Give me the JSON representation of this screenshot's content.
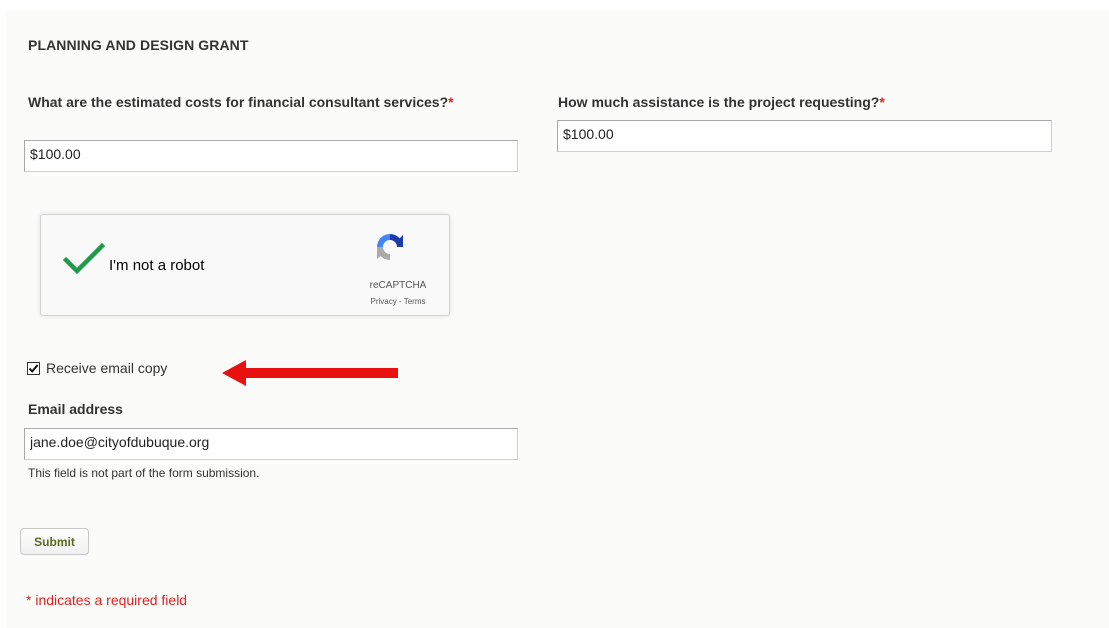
{
  "section": {
    "title": "PLANNING AND DESIGN GRANT"
  },
  "fields": {
    "consultant_costs": {
      "label": "What are the estimated costs for financial consultant services?",
      "required_marker": "*",
      "value": "$100.00"
    },
    "assistance": {
      "label": "How much assistance is the project requesting?",
      "required_marker": "*",
      "value": "$100.00"
    },
    "email": {
      "label": "Email address",
      "value": "jane.doe@cityofdubuque.org",
      "help": "This field is not part of the form submission."
    }
  },
  "recaptcha": {
    "label": "I'm not a robot",
    "checked": true,
    "brand": "reCAPTCHA",
    "privacy_link": "Privacy",
    "separator": " - ",
    "terms_link": "Terms"
  },
  "email_copy": {
    "label": "Receive email copy",
    "checked": true
  },
  "submit": {
    "label": "Submit"
  },
  "footer": {
    "required_note": "* indicates a required field"
  },
  "colors": {
    "required": "#e02020",
    "annotation_arrow": "#e8110f",
    "check_green": "#1e9a48",
    "submit_text": "#5a6a1c"
  },
  "icons": {
    "recaptcha_check": "checkmark-icon",
    "recaptcha_logo": "recaptcha-logo-icon",
    "annotation": "red-arrow-icon"
  }
}
